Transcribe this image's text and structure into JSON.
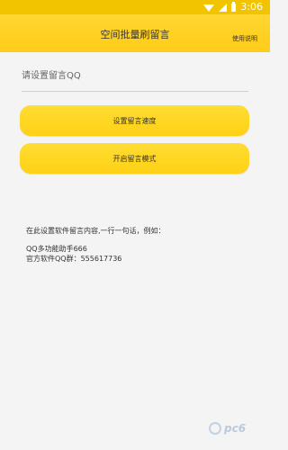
{
  "status_bar": {
    "time": "3:06",
    "icons": [
      "wifi-icon",
      "signal-icon",
      "battery-icon"
    ],
    "background": "#f2c400"
  },
  "header": {
    "title": "空间批量刷留言",
    "help_label": "使用说明",
    "background": "#ffd630"
  },
  "qq_field": {
    "placeholder": "请设置留言QQ",
    "value": ""
  },
  "buttons": {
    "set_speed": "设置留言速度",
    "start_mode": "开启留言模式",
    "color": "#ffd626"
  },
  "instructions": {
    "intro": "在此设置软件留言内容,一行一句话，例如：",
    "example_1": "QQ多功能助手666",
    "example_2": "官方软件QQ群：555617736"
  },
  "watermark": {
    "text": "pc6"
  }
}
